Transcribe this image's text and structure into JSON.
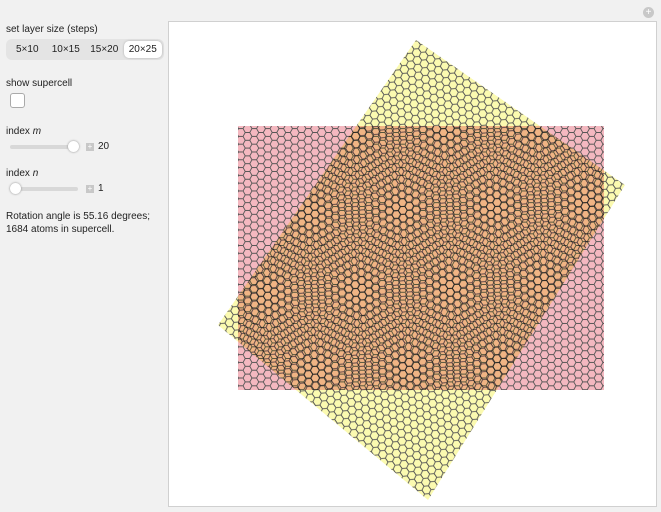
{
  "controls": {
    "layer_size_label": "set layer size (steps)",
    "layer_sizes": [
      "5×10",
      "10×15",
      "15×20",
      "20×25"
    ],
    "selected_layer_size": "20×25",
    "supercell_label": "show supercell",
    "supercell_checked": false,
    "index_m_label": "index ",
    "index_m_var": "m",
    "index_m_value": "20",
    "index_m_fraction": 1.0,
    "index_n_label": "index ",
    "index_n_var": "n",
    "index_n_value": "1",
    "index_n_fraction": 0.0
  },
  "result": {
    "line1": "Rotation angle is 55.16 degrees;",
    "line2": "1684 atoms in supercell."
  },
  "colors": {
    "layer1": "#f4b8c0",
    "layer2": "#fbfab0",
    "edge": "#555555"
  }
}
